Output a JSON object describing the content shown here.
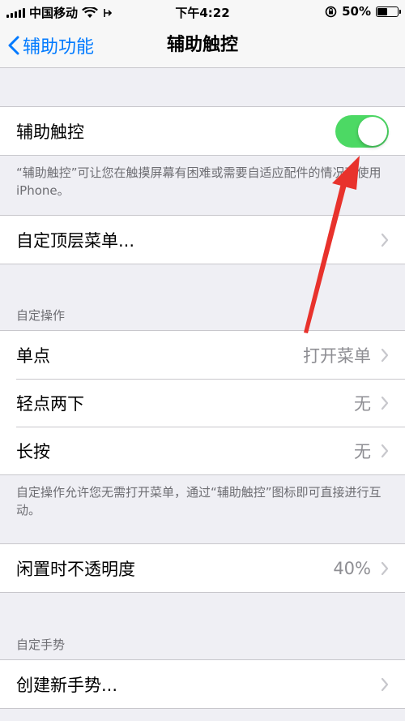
{
  "status_bar": {
    "carrier": "中国移动",
    "time": "下午4:22",
    "battery_pct": "50%",
    "battery_level": 0.5
  },
  "nav": {
    "back_label": "辅助功能",
    "title": "辅助触控"
  },
  "assistive_touch": {
    "label": "辅助触控",
    "enabled": true,
    "footer": "“辅助触控”可让您在触摸屏幕有困难或需要自适应配件的情况下使用 iPhone。"
  },
  "customize_menu": {
    "label": "自定顶层菜单..."
  },
  "custom_actions": {
    "header": "自定操作",
    "rows": [
      {
        "label": "单点",
        "value": "打开菜单"
      },
      {
        "label": "轻点两下",
        "value": "无"
      },
      {
        "label": "长按",
        "value": "无"
      }
    ],
    "footer": "自定操作允许您无需打开菜单，通过“辅助触控”图标即可直接进行互动。"
  },
  "idle_opacity": {
    "label": "闲置时不透明度",
    "value": "40%"
  },
  "custom_gestures": {
    "header": "自定手势",
    "create_label": "创建新手势..."
  },
  "colors": {
    "accent": "#007aff",
    "toggle_on": "#4cd964",
    "annotation_arrow": "#e8322c"
  }
}
